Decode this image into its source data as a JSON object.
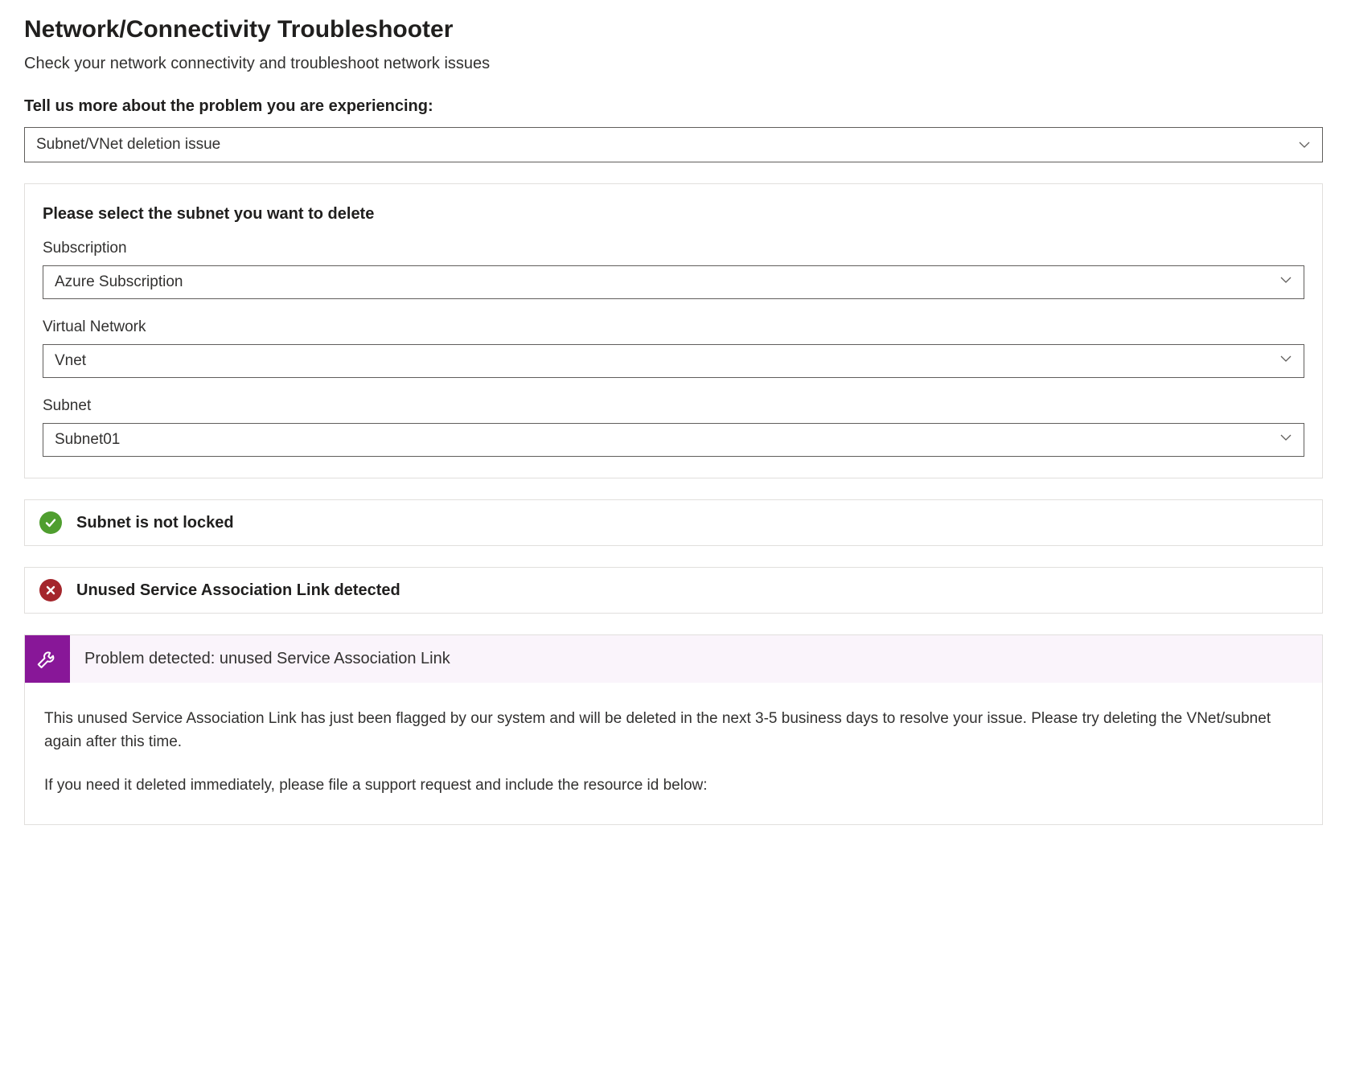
{
  "header": {
    "title": "Network/Connectivity Troubleshooter",
    "subtitle": "Check your network connectivity and troubleshoot network issues"
  },
  "problem_prompt": {
    "label": "Tell us more about the problem you are experiencing:",
    "selected": "Subnet/VNet deletion issue"
  },
  "subnet_panel": {
    "title": "Please select the subnet you want to delete",
    "fields": {
      "subscription": {
        "label": "Subscription",
        "value": "Azure Subscription"
      },
      "vnet": {
        "label": "Virtual Network",
        "value": "Vnet"
      },
      "subnet": {
        "label": "Subnet",
        "value": "Subnet01"
      }
    }
  },
  "checks": {
    "lock": {
      "status": "success",
      "text": "Subnet is not locked"
    },
    "sal": {
      "status": "error",
      "text": "Unused Service Association Link detected"
    }
  },
  "detection": {
    "title": "Problem detected: unused Service Association Link",
    "paragraph1": "This unused Service Association Link has just been flagged by our system and will be deleted in the next 3-5 business days to resolve your issue. Please try deleting the VNet/subnet again after this time.",
    "paragraph2": "If you need it deleted immediately, please file a support request and include the resource id below:"
  }
}
